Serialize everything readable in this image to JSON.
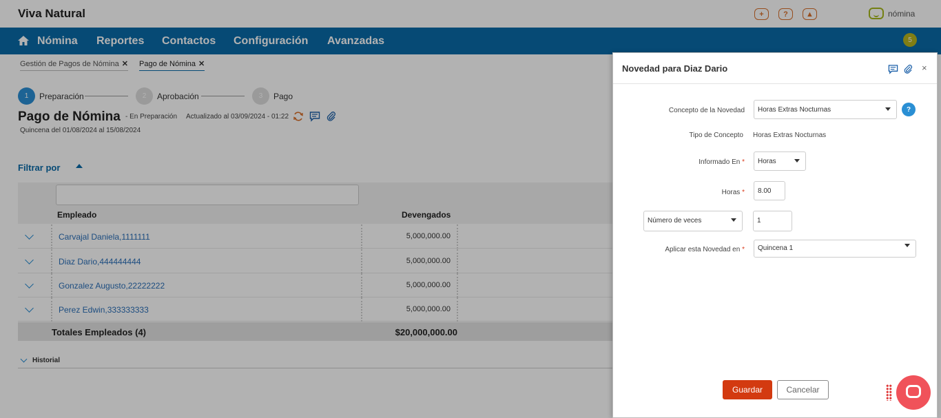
{
  "app": {
    "brand": "Viva Natural",
    "logo_text": "nómina",
    "notification_count": "5"
  },
  "header_icons": [
    {
      "name": "add-icon",
      "glyph": "+"
    },
    {
      "name": "help-icon",
      "glyph": "?"
    },
    {
      "name": "user-icon",
      "glyph": "▲"
    }
  ],
  "nav": {
    "items": [
      "Nómina",
      "Reportes",
      "Contactos",
      "Configuración",
      "Avanzadas"
    ]
  },
  "breadcrumbs": [
    {
      "label": "Gestión de Pagos de Nómina",
      "active": false
    },
    {
      "label": "Pago de Nómina",
      "active": true
    }
  ],
  "stepper": [
    {
      "num": "1",
      "label": "Preparación",
      "active": true
    },
    {
      "num": "2",
      "label": "Aprobación",
      "active": false
    },
    {
      "num": "3",
      "label": "Pago",
      "active": false
    }
  ],
  "page": {
    "title": "Pago de Nómina",
    "status": "- En Preparación",
    "updated": "Actualizado al 03/09/2024 - 01:22",
    "subtitle": "Quincena del 01/08/2024 al 15/08/2024",
    "filter_label": "Filtrar por"
  },
  "table": {
    "columns": [
      "Empleado",
      "Devengados"
    ],
    "rows": [
      {
        "name": "Carvajal Daniela,1111111",
        "devengados": "5,000,000.00"
      },
      {
        "name": "Diaz Dario,444444444",
        "devengados": "5,000,000.00"
      },
      {
        "name": "Gonzalez Augusto,22222222",
        "devengados": "5,000,000.00"
      },
      {
        "name": "Perez Edwin,333333333",
        "devengados": "5,000,000.00"
      }
    ],
    "totals_label": "Totales Empleados (4)",
    "totals_value": "$20,000,000.00"
  },
  "history_label": "Historial",
  "panel": {
    "title": "Novedad para Diaz Dario",
    "concepto_label": "Concepto de la Novedad",
    "concepto_value": "Horas Extras Nocturnas",
    "tipo_label": "Tipo de Concepto",
    "tipo_value": "Horas Extras Nocturnas",
    "informado_label": "Informado En",
    "informado_value": "Horas",
    "horas_label": "Horas",
    "horas_value": "8.00",
    "numero_select": "Número de veces",
    "numero_value": "1",
    "aplicar_label": "Aplicar esta Novedad en",
    "aplicar_value": "Quincena 1",
    "required_mark": "*",
    "help_glyph": "?",
    "close_glyph": "×",
    "save_label": "Guardar",
    "cancel_label": "Cancelar"
  },
  "colors": {
    "nav": "#0a6aa8",
    "accent": "#d33a10",
    "link": "#2a6fb8",
    "chat": "#f0525a"
  }
}
